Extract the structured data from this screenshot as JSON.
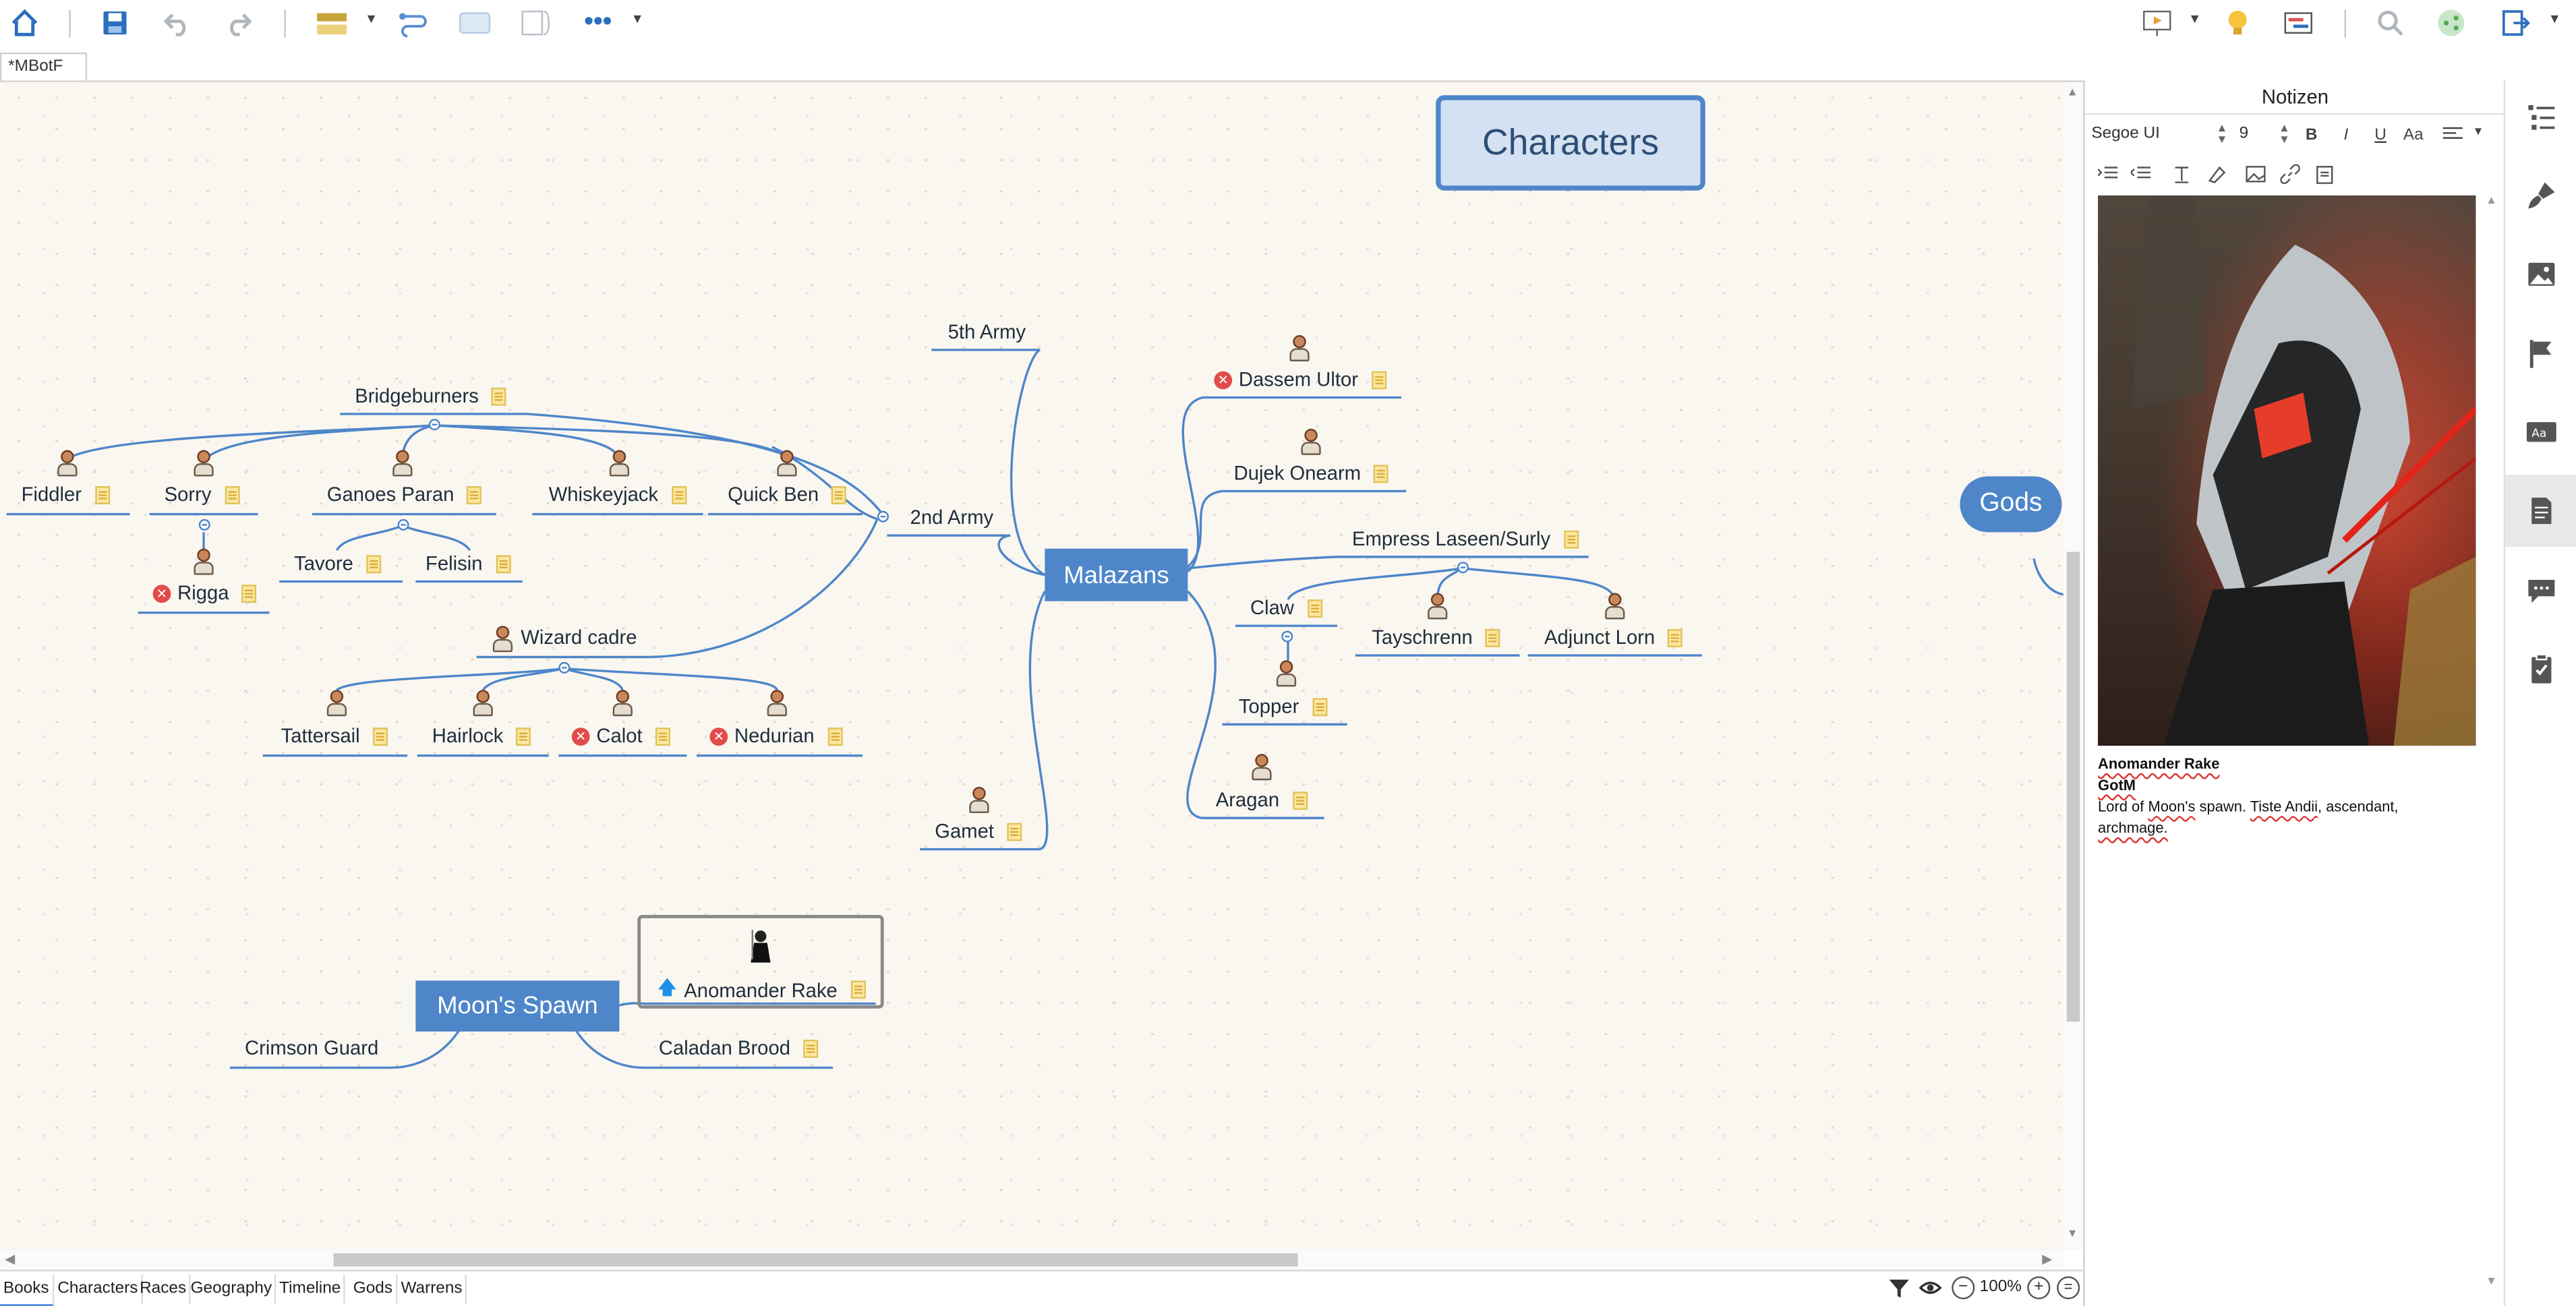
{
  "app": {
    "doc_tab": "*MBotF"
  },
  "toolbar": {
    "home_icon": "home-icon",
    "save_icon": "save-icon",
    "undo_icon": "undo-icon",
    "redo_icon": "redo-icon",
    "more_label": "•••"
  },
  "canvas": {
    "floating_title": "Characters",
    "gods_topic": "Gods",
    "topics": {
      "malazans": "Malazans",
      "moons_spawn": "Moon's Spawn"
    },
    "nodes": {
      "fifth_army": "5th Army",
      "second_army": "2nd Army",
      "bridgeburners": "Bridgeburners",
      "fiddler": "Fiddler",
      "sorry": "Sorry",
      "ganoes_paran": "Ganoes Paran",
      "whiskeyjack": "Whiskeyjack",
      "quick_ben": "Quick Ben",
      "rigga": "Rigga",
      "tavore": "Tavore",
      "felisin": "Felisin",
      "wizard_cadre": "Wizard cadre",
      "tattersail": "Tattersail",
      "hairlock": "Hairlock",
      "calot": "Calot",
      "nedurian": "Nedurian",
      "gamet": "Gamet",
      "dassem_ultor": "Dassem Ultor",
      "dujek_onearm": "Dujek Onearm",
      "empress": "Empress Laseen/Surly",
      "claw": "Claw",
      "tayschrenn": "Tayschrenn",
      "adjunct_lorn": "Adjunct Lorn",
      "topper": "Topper",
      "aragan": "Aragan",
      "anomander_rake": "Anomander Rake",
      "crimson_guard": "Crimson Guard",
      "caladan_brood": "Caladan Brood"
    }
  },
  "sheets": [
    "Books",
    "Characters",
    "Races",
    "Geography",
    "Timeline",
    "Gods",
    "Warrens"
  ],
  "active_sheet": "Books",
  "status": {
    "zoom": "100%"
  },
  "notes": {
    "title": "Notizen",
    "font": "Segoe UI",
    "size": "9",
    "bold": "B",
    "italic": "I",
    "underline": "U",
    "case": "Aa",
    "line1": "Anomander Rake",
    "line2": "GotM",
    "line3_a": "Lord of ",
    "line3_b": "Moon's",
    "line3_c": " spawn. ",
    "line3_d": "Tiste Andii",
    "line3_e": ", ascendant,",
    "line4": "archmage."
  },
  "colors": {
    "accent": "#4e86c9",
    "line": "#4e86c9",
    "badge_red": "#e24b4b"
  }
}
